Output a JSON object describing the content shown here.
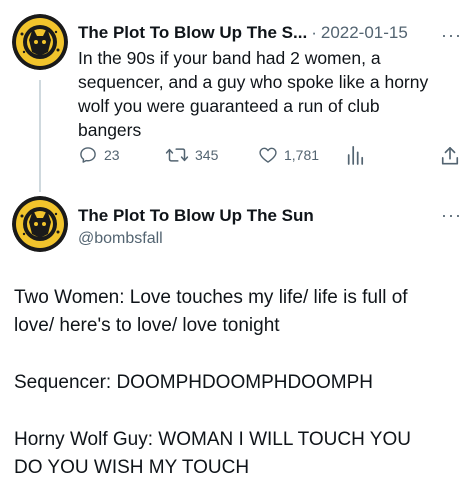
{
  "tweet1": {
    "author_name": "The Plot To Blow Up The S...",
    "separator": "·",
    "date": "2022-01-15",
    "text_lines": [
      "In the 90s if your band had 2 women, a",
      "sequencer, and a guy who spoke like a horny",
      "wolf you were guaranteed a run of club",
      "bangers"
    ],
    "replies": "23",
    "retweets": "345",
    "likes": "1,781",
    "icons": [
      "reply-icon",
      "retweet-icon",
      "like-icon",
      "analytics-icon",
      "share-icon"
    ]
  },
  "tweet2": {
    "author_name": "The Plot To Blow Up The Sun",
    "handle": "@bombsfall",
    "lines": [
      "Two Women: Love touches my life/ life is full of",
      "love/ here's to love/ love tonight",
      "Sequencer: DOOMPHDOOMPHDOOMPH",
      "Horny Wolf Guy: WOMAN I WILL TOUCH YOU",
      "DO YOU WISH MY TOUCH"
    ]
  },
  "more_menu": "···",
  "colors": {
    "text": "#0f1419",
    "muted": "#536471",
    "avatar_bg": "#f2c42c",
    "avatar_ring": "#1a1a1a",
    "thread_line": "#cfd9de"
  }
}
